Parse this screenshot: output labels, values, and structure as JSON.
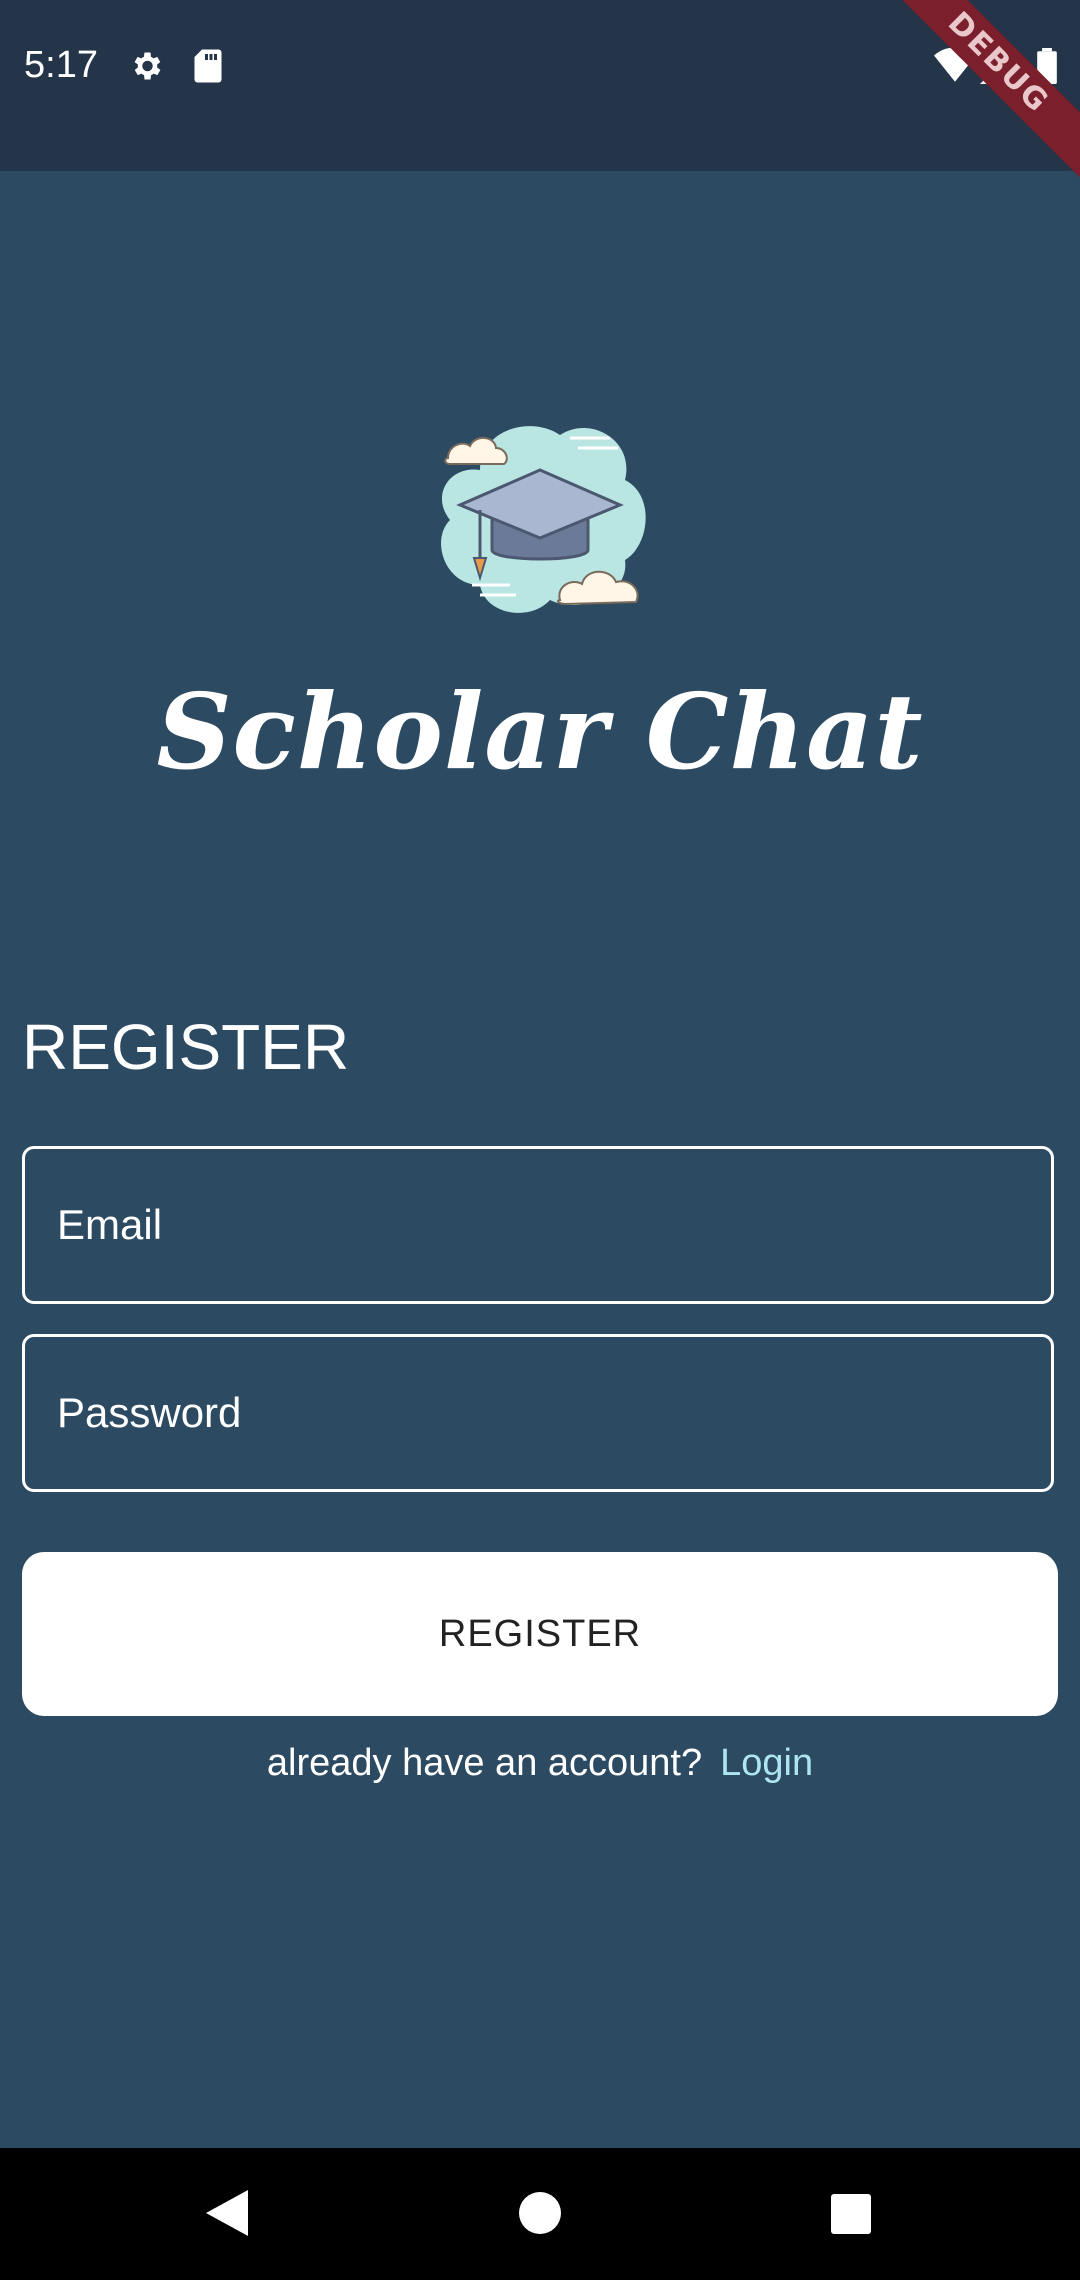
{
  "status_bar": {
    "time": "5:17",
    "icons": [
      "gear-icon",
      "sd-card-icon",
      "wifi-icon",
      "signal-icon",
      "battery-icon"
    ],
    "debug_banner": "DEBUG"
  },
  "app": {
    "logo_icon": "graduation-cap-logo",
    "title": "Scholar Chat"
  },
  "form": {
    "section_title": "REGISTER",
    "email_placeholder": "Email",
    "password_placeholder": "Password",
    "submit_label": "REGISTER",
    "footer_text": "already have an account?",
    "login_link": "Login"
  },
  "nav_bar": {
    "buttons": [
      "back-icon",
      "home-icon",
      "recents-icon"
    ]
  },
  "colors": {
    "background": "#2c4a62",
    "status_bar": "#243549",
    "link": "#aee6ef",
    "button": "#ffffff"
  }
}
